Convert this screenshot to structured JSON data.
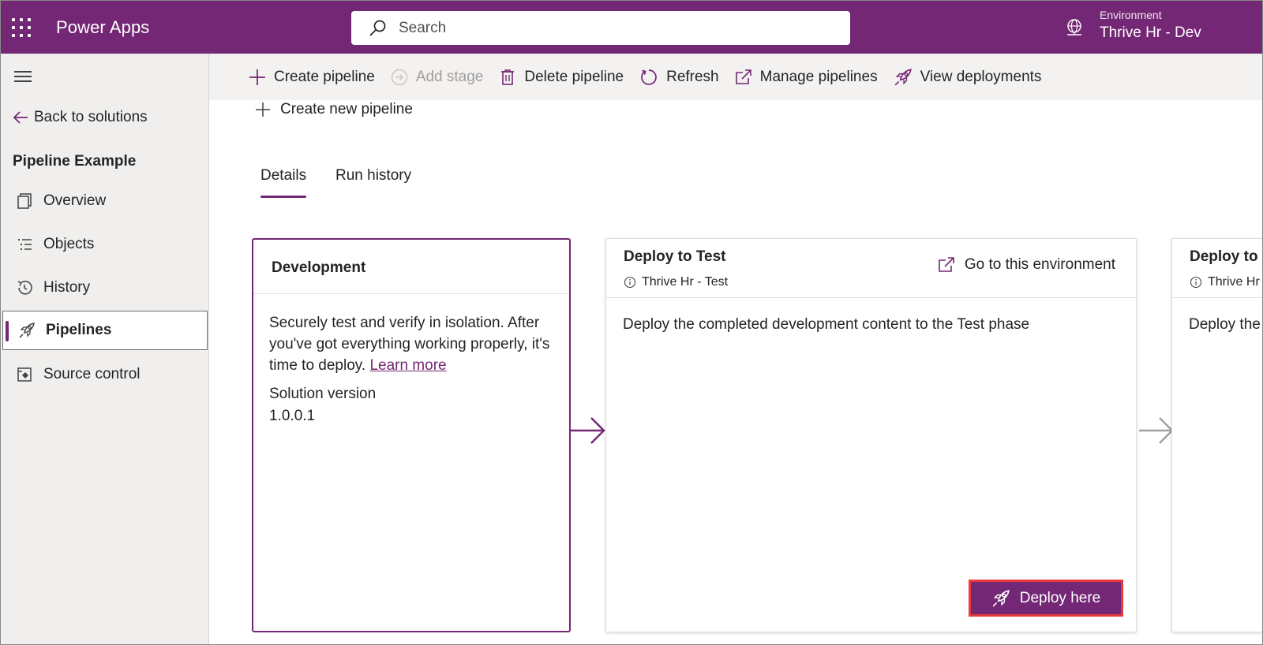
{
  "app": {
    "name": "Power Apps"
  },
  "search": {
    "placeholder": "Search"
  },
  "environment": {
    "label": "Environment",
    "value": "Thrive Hr - Dev"
  },
  "sidebar": {
    "back_label": "Back to solutions",
    "solution_title": "Pipeline Example",
    "items": [
      {
        "label": "Overview",
        "icon": "overview-icon"
      },
      {
        "label": "Objects",
        "icon": "objects-icon"
      },
      {
        "label": "History",
        "icon": "history-icon"
      },
      {
        "label": "Pipelines",
        "icon": "rocket-icon",
        "active": true
      },
      {
        "label": "Source control",
        "icon": "source-control-icon"
      }
    ]
  },
  "commands": {
    "create_pipeline": "Create pipeline",
    "add_stage": "Add stage",
    "delete_pipeline": "Delete pipeline",
    "refresh": "Refresh",
    "manage_pipelines": "Manage pipelines",
    "view_deployments": "View deployments"
  },
  "main": {
    "create_new_pipeline": "Create new pipeline",
    "tabs": [
      {
        "label": "Details",
        "active": true
      },
      {
        "label": "Run history",
        "active": false
      }
    ],
    "development": {
      "title": "Development",
      "description": "Securely test and verify in isolation. After you've got everything working properly, it's time to deploy.",
      "learn_more": "Learn more",
      "version_label": "Solution version",
      "version_value": "1.0.0.1"
    },
    "stages": [
      {
        "title": "Deploy to Test",
        "environment": "Thrive Hr - Test",
        "go_to_env": "Go to this environment",
        "description": "Deploy the completed development content to the Test phase",
        "deploy_button": "Deploy here"
      },
      {
        "title": "Deploy to I",
        "environment": "Thrive Hr",
        "description": "Deploy the"
      }
    ]
  },
  "colors": {
    "brand": "#742774",
    "highlight": "#e83a3a"
  }
}
